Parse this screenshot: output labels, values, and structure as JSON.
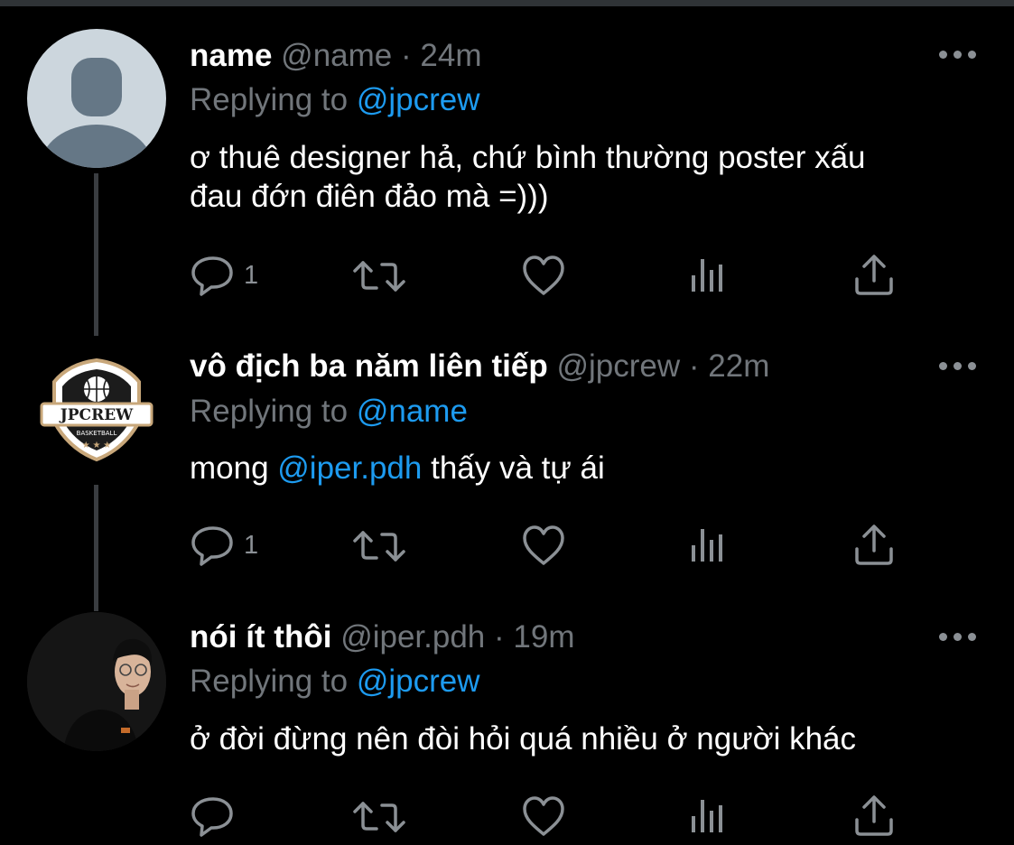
{
  "tweets": [
    {
      "name": "name",
      "handle": "@name",
      "separator": "·",
      "time": "24m",
      "replying_label": "Replying to",
      "replying_to": "@jpcrew",
      "text_line1": "ơ thuê designer hả, chứ bình thường poster xấu",
      "text_line2": "đau đớn điên đảo mà =)))",
      "reply_count": "1",
      "avatar": "default-avatar-icon"
    },
    {
      "name": "vô địch ba năm liên tiếp",
      "handle": "@jpcrew",
      "separator": "·",
      "time": "22m",
      "replying_label": "Replying to",
      "replying_to": "@name",
      "text_before": "mong ",
      "mention": "@iper.pdh",
      "text_after": " thấy và tự ái",
      "reply_count": "1",
      "avatar_logo_text": "JPCREW",
      "avatar_logo_subtext": "BASKETBALL"
    },
    {
      "name": "nói ít thôi",
      "handle": "@iper.pdh",
      "separator": "·",
      "time": "19m",
      "replying_label": "Replying to",
      "replying_to": "@jpcrew",
      "text": "ở đời đừng nên đòi hỏi quá nhiều ở người khác",
      "reply_count": "",
      "avatar": "person-photo"
    }
  ],
  "colors": {
    "background": "#000000",
    "text": "#ffffff",
    "secondary": "#71767b",
    "link": "#1d9bf0",
    "icon": "#8b9095"
  }
}
